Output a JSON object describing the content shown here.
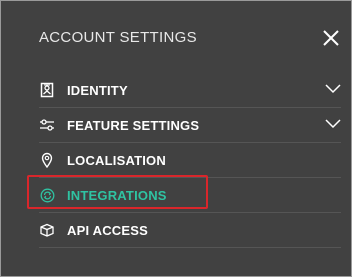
{
  "panel": {
    "title": "ACCOUNT SETTINGS",
    "close_icon": "close-icon"
  },
  "menu": {
    "items": [
      {
        "label": "IDENTITY",
        "icon": "identity-icon",
        "has_chevron": true
      },
      {
        "label": "FEATURE SETTINGS",
        "icon": "sliders-icon",
        "has_chevron": true
      },
      {
        "label": "LOCALISATION",
        "icon": "location-pin-icon",
        "has_chevron": false
      },
      {
        "label": "INTEGRATIONS",
        "icon": "sync-icon",
        "has_chevron": false,
        "active": true
      },
      {
        "label": "API ACCESS",
        "icon": "box-icon",
        "has_chevron": false
      }
    ]
  },
  "colors": {
    "panel_bg": "#414141",
    "active_text": "#2fc3a2",
    "highlight_border": "#d9262b"
  }
}
